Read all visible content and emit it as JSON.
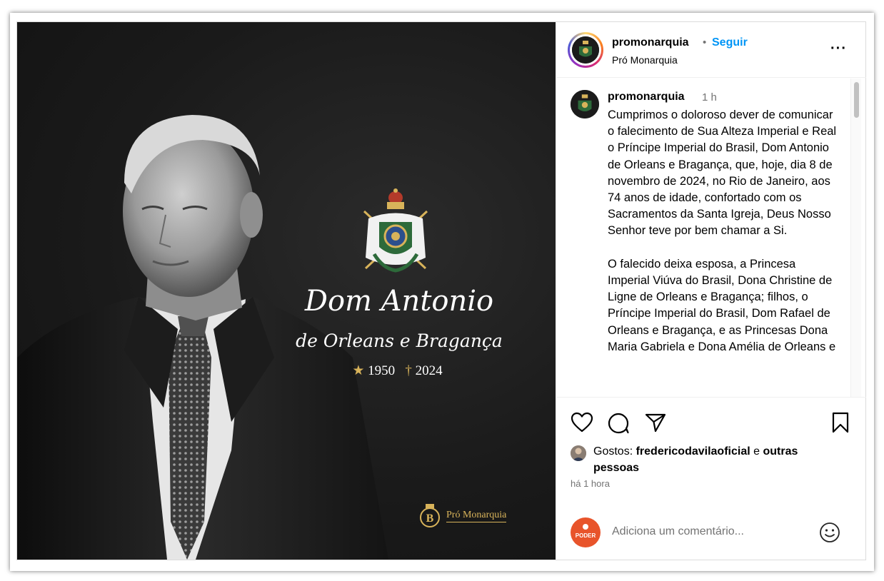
{
  "post_image": {
    "name_line1": "Dom Antonio",
    "name_line2": "de Orleans e Bragança",
    "birth_year": "1950",
    "death_year": "2024",
    "star_symbol": "★",
    "cross_symbol": "†",
    "brand_text": "Pró Monarquia",
    "brand_icon": "crest-b-icon"
  },
  "header": {
    "username": "promonarquia",
    "separator": "•",
    "follow_label": "Seguir",
    "subtitle": "Pró Monarquia",
    "more_label": "···"
  },
  "caption": {
    "username": "promonarquia",
    "time": "1 h",
    "text": "Cumprimos o doloroso dever de comunicar o falecimento de Sua Alteza Imperial e Real o Príncipe Imperial do Brasil, Dom Antonio de Orleans e Bragança, que, hoje, dia 8 de novembro de 2024, no Rio de Janeiro, aos 74 anos de idade, confortado com os Sacramentos da Santa Igreja, Deus Nosso Senhor teve por bem chamar a Si.\n\nO falecido deixa esposa, a Princesa Imperial Viúva do Brasil, Dona Christine de Ligne de Orleans e Bragança; filhos, o Príncipe Imperial do Brasil, Dom Rafael de Orleans e Bragança, e as Princesas Dona Maria Gabriela e Dona Amélia de Orleans e"
  },
  "actions": {
    "icons": [
      "heart-icon",
      "comment-icon",
      "share-icon",
      "bookmark-icon"
    ],
    "likes_prefix": "Gostos:",
    "likes_user": "fredericodavilaoficial",
    "likes_joiner": "e",
    "likes_others": "outras pessoas",
    "time_ago": "há 1 hora"
  },
  "comment": {
    "avatar_label": "PODER",
    "placeholder": "Adiciona um comentário...",
    "emoji_icon": "smiley-icon"
  },
  "colors": {
    "accent_blue": "#0095f6",
    "gold": "#d8b35a",
    "poder_orange": "#e8542b"
  }
}
